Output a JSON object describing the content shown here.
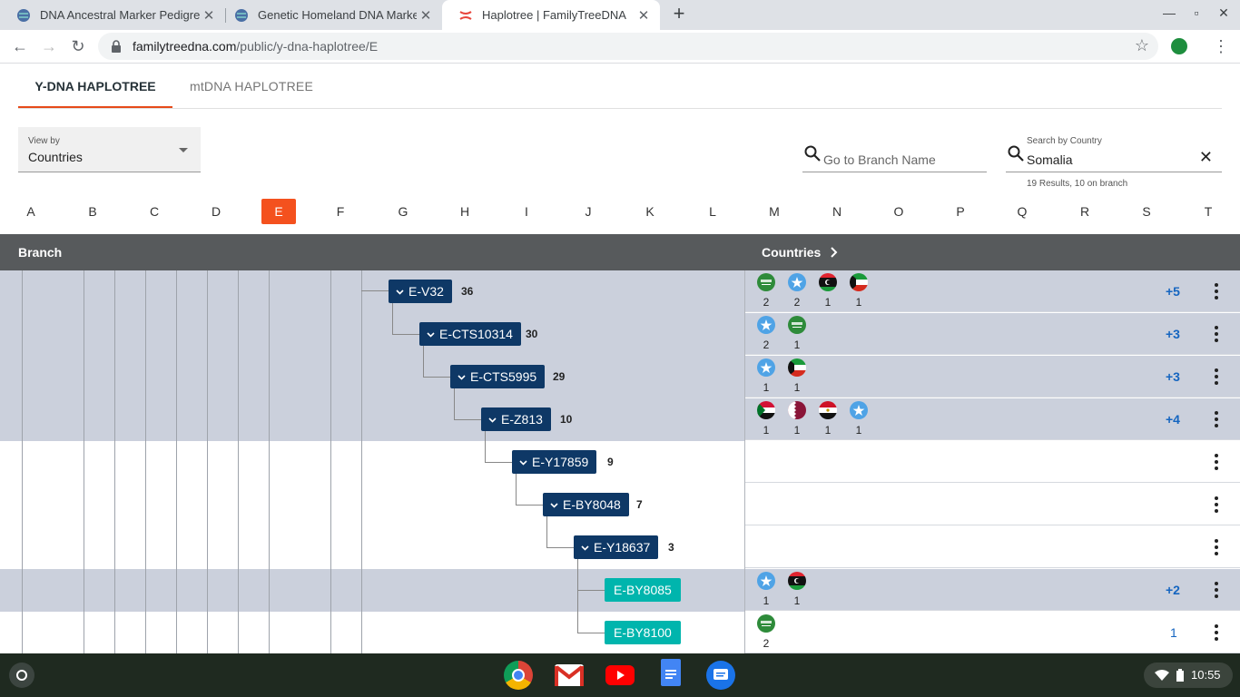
{
  "browser": {
    "tabs": [
      {
        "title": "DNA Ancestral Marker Pedigree"
      },
      {
        "title": "Genetic Homeland DNA Marker Ma"
      },
      {
        "title": "Haplotree | FamilyTreeDNA"
      }
    ],
    "url_host": "familytreedna.com",
    "url_path": "/public/y-dna-haplotree/E"
  },
  "page": {
    "tabs": [
      "Y-DNA HAPLOTREE",
      "mtDNA HAPLOTREE"
    ],
    "view_by": {
      "label": "View by",
      "value": "Countries"
    },
    "branch_search": {
      "placeholder": "Go to Branch Name"
    },
    "country_search": {
      "label": "Search by Country",
      "value": "Somalia",
      "results": "19 Results, 10 on branch"
    },
    "letters": [
      "A",
      "B",
      "C",
      "D",
      "E",
      "F",
      "G",
      "H",
      "I",
      "J",
      "K",
      "L",
      "M",
      "N",
      "O",
      "P",
      "Q",
      "R",
      "S",
      "T"
    ],
    "selected_letter": "E",
    "table": {
      "branch_header": "Branch",
      "countries_header": "Countries",
      "chevron": "⌄",
      "rows": [
        {
          "name": "E-V32",
          "count": "36",
          "flags": [
            {
              "c": "saudi",
              "n": "2"
            },
            {
              "c": "somalia",
              "n": "2"
            },
            {
              "c": "libya",
              "n": "1"
            },
            {
              "c": "kuwait",
              "n": "1"
            }
          ],
          "more": "+5",
          "shaded": true,
          "style": "dark"
        },
        {
          "name": "E-CTS10314",
          "count": "30",
          "flags": [
            {
              "c": "somalia",
              "n": "2"
            },
            {
              "c": "saudi",
              "n": "1"
            }
          ],
          "more": "+3",
          "shaded": true,
          "style": "dark"
        },
        {
          "name": "E-CTS5995",
          "count": "29",
          "flags": [
            {
              "c": "somalia",
              "n": "1"
            },
            {
              "c": "kuwait",
              "n": "1"
            }
          ],
          "more": "+3",
          "shaded": true,
          "style": "dark"
        },
        {
          "name": "E-Z813",
          "count": "10",
          "flags": [
            {
              "c": "sudan",
              "n": "1"
            },
            {
              "c": "qatar",
              "n": "1"
            },
            {
              "c": "egypt",
              "n": "1"
            },
            {
              "c": "somalia",
              "n": "1"
            }
          ],
          "more": "+4",
          "shaded": true,
          "style": "dark"
        },
        {
          "name": "E-Y17859",
          "count": "9",
          "flags": [],
          "more": "",
          "shaded": false,
          "style": "dark"
        },
        {
          "name": "E-BY8048",
          "count": "7",
          "flags": [],
          "more": "",
          "shaded": false,
          "style": "dark"
        },
        {
          "name": "E-Y18637",
          "count": "3",
          "flags": [],
          "more": "",
          "shaded": false,
          "style": "dark"
        },
        {
          "name": "E-BY8085",
          "count": "",
          "flags": [
            {
              "c": "somalia",
              "n": "1"
            },
            {
              "c": "libya",
              "n": "1"
            }
          ],
          "more": "+2",
          "shaded": true,
          "style": "teal"
        },
        {
          "name": "E-BY8100",
          "count": "",
          "flags": [
            {
              "c": "saudi",
              "n": "2"
            }
          ],
          "more": "1",
          "shaded": false,
          "style": "teal"
        }
      ]
    }
  },
  "system": {
    "time": "10:55"
  },
  "colors": {
    "accent": "#f4511e",
    "node_dark": "#0e3866",
    "node_teal": "#00b5ad",
    "header": "#575a5c",
    "shade": "#cbd0dc"
  }
}
